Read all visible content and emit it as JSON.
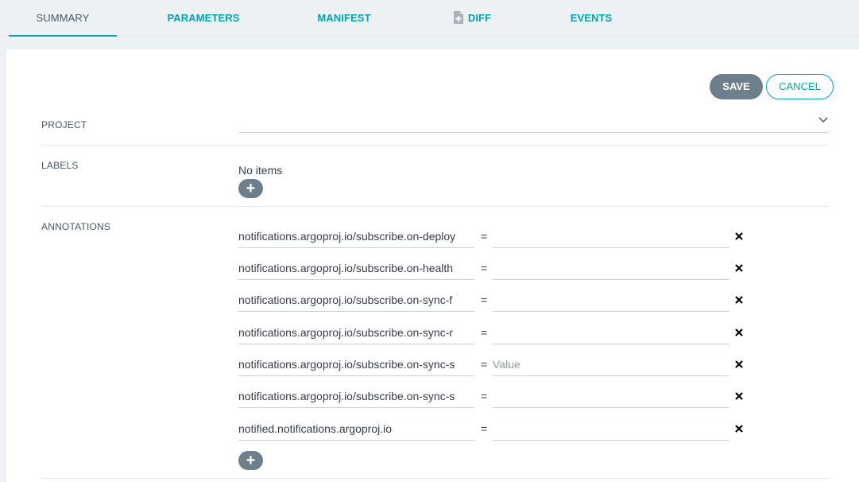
{
  "tabs": [
    {
      "label": "SUMMARY",
      "active": true
    },
    {
      "label": "PARAMETERS"
    },
    {
      "label": "MANIFEST"
    },
    {
      "label": "DIFF",
      "icon": "file-diff-icon"
    },
    {
      "label": "EVENTS"
    }
  ],
  "actions": {
    "save": "SAVE",
    "cancel": "CANCEL"
  },
  "project": {
    "label": "PROJECT",
    "value": ""
  },
  "labels": {
    "label": "LABELS",
    "empty_text": "No items",
    "add_icon": "+"
  },
  "annotations": {
    "label": "ANNOTATIONS",
    "add_icon": "+",
    "value_placeholder": "Value",
    "items": [
      {
        "key": "notifications.argoproj.io/subscribe.on-deploy",
        "eq": "=",
        "value": ""
      },
      {
        "key": "notifications.argoproj.io/subscribe.on-health",
        "eq": "=",
        "value": ""
      },
      {
        "key": "notifications.argoproj.io/subscribe.on-sync-f",
        "eq": "=",
        "value": ""
      },
      {
        "key": "notifications.argoproj.io/subscribe.on-sync-r",
        "eq": "=",
        "value": ""
      },
      {
        "key": "notifications.argoproj.io/subscribe.on-sync-s",
        "eq": "=",
        "value": "",
        "placeholder": "Value"
      },
      {
        "key": "notifications.argoproj.io/subscribe.on-sync-s",
        "eq": "=",
        "value": ""
      },
      {
        "key": "notified.notifications.argoproj.io",
        "eq": "=",
        "value": ""
      }
    ]
  },
  "colors": {
    "accent": "#00a2b3",
    "button_gray": "#6d7f8b",
    "background": "#eef1f4"
  }
}
